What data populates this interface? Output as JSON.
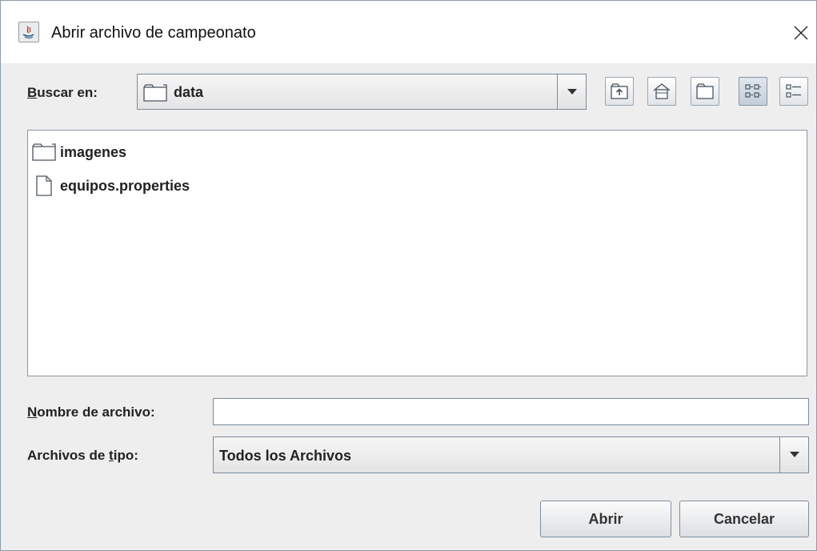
{
  "window": {
    "title": "Abrir archivo de campeonato",
    "close_glyph": "✕"
  },
  "look_in": {
    "label_mnemonic": "B",
    "label_rest": "uscar en:",
    "value": "data"
  },
  "toolbar": {
    "icons": [
      "up-folder-icon",
      "home-icon",
      "new-folder-icon",
      "list-view-icon",
      "details-view-icon"
    ]
  },
  "files": [
    {
      "name": "imagenes",
      "type": "folder"
    },
    {
      "name": "equipos.properties",
      "type": "file"
    }
  ],
  "file_name": {
    "label_mnemonic": "N",
    "label_rest": "ombre de archivo:",
    "value": ""
  },
  "file_type": {
    "label_before": "Archivos de ",
    "label_mnemonic": "t",
    "label_after": "ipo:",
    "value": "Todos los Archivos"
  },
  "buttons": {
    "open_label": "Abrir",
    "cancel_label": "Cancelar"
  }
}
